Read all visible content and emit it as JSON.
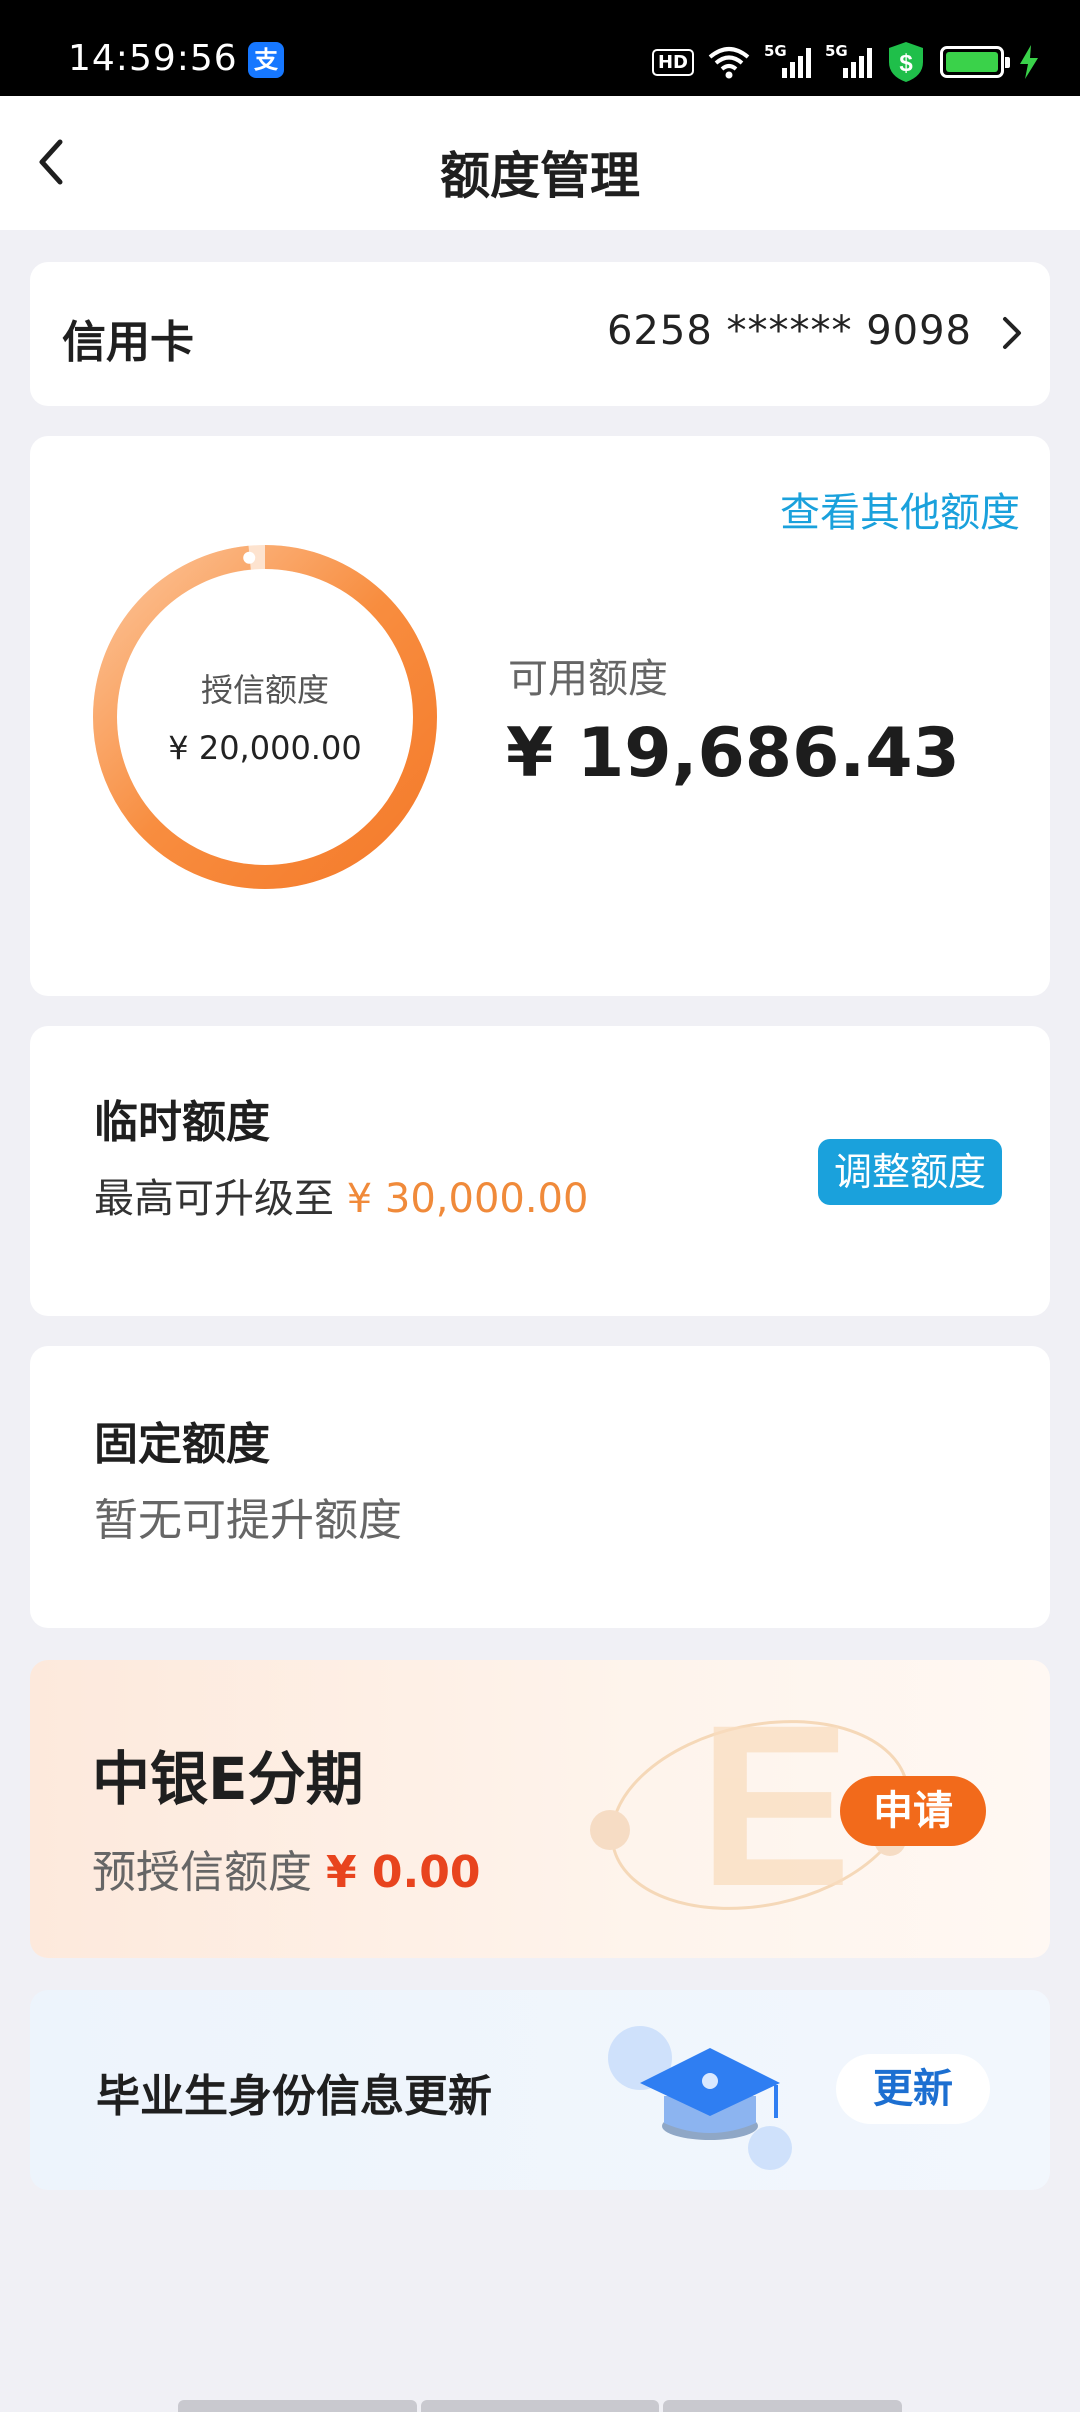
{
  "status_bar": {
    "time": "14:59:56",
    "alipay_badge": "支",
    "hd_label": "HD",
    "signal_label_1": "5G",
    "signal_label_2": "5G"
  },
  "header": {
    "title": "额度管理"
  },
  "card_account": {
    "label": "信用卡",
    "card_number": "6258 ****** 9098"
  },
  "card_credit": {
    "link": "查看其他额度",
    "ring_label": "授信额度",
    "ring_value": "¥ 20,000.00",
    "available_label": "可用额度",
    "available_value": "¥ 19,686.43",
    "available_fraction": 0.9843
  },
  "card_temp": {
    "title": "临时额度",
    "subtitle_prefix": "最高可升级至 ",
    "subtitle_amount": "¥ 30,000.00",
    "button": "调整额度"
  },
  "card_fixed": {
    "title": "固定额度",
    "subtitle": "暂无可提升额度"
  },
  "card_installment": {
    "title": "中银E分期",
    "subtitle_prefix": "预授信额度 ",
    "subtitle_amount": "¥ 0.00",
    "button": "申请"
  },
  "card_graduate": {
    "title": "毕业生身份信息更新",
    "button": "更新"
  },
  "colors": {
    "accent_blue": "#1aa1dc",
    "ring_orange": "#f58a3c",
    "apply_orange": "#f26a1b",
    "amount_red": "#e8441e"
  }
}
